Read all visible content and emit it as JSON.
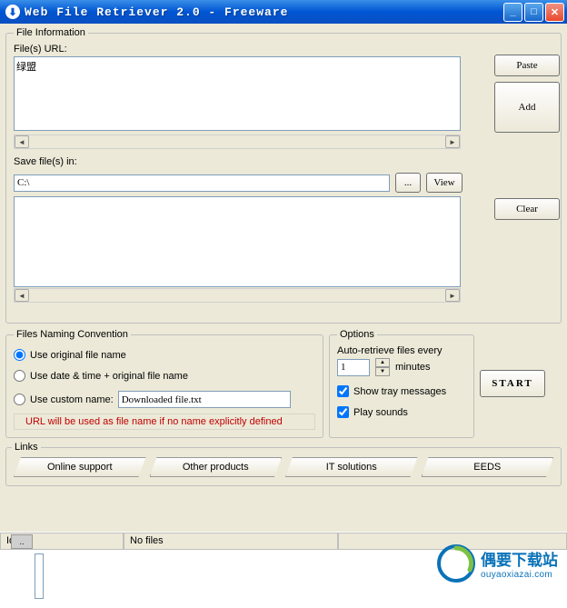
{
  "window": {
    "title": "Web File Retriever 2.0 - Freeware"
  },
  "fileInfo": {
    "legend": "File Information",
    "urlLabel": "File(s) URL:",
    "urlValue": "绿盟",
    "saveLabel": "Save file(s) in:",
    "savePath": "C:\\",
    "browseBtn": "...",
    "viewBtn": "View",
    "pasteBtn": "Paste",
    "addBtn": "Add",
    "clearBtn": "Clear"
  },
  "naming": {
    "legend": "Files Naming Convention",
    "opt1": "Use original file name",
    "opt2": "Use date & time + original file name",
    "opt3": "Use custom name:",
    "customValue": "Downloaded file.txt",
    "note": "URL will be used as file name if no name explicitly defined"
  },
  "options": {
    "legend": "Options",
    "autoLabel": "Auto-retrieve files every",
    "autoValue": "1",
    "minutes": "minutes",
    "trayLabel": "Show tray messages",
    "soundsLabel": "Play sounds"
  },
  "startBtn": "START",
  "links": {
    "legend": "Links",
    "l1": "Online support",
    "l2": "Other products",
    "l3": "IT solutions",
    "l4": "EEDS"
  },
  "status": {
    "s1": "Idle",
    "s2": "No files"
  },
  "watermark": {
    "cn": "偶要下载站",
    "en": "ouyaoxiazai.com"
  }
}
